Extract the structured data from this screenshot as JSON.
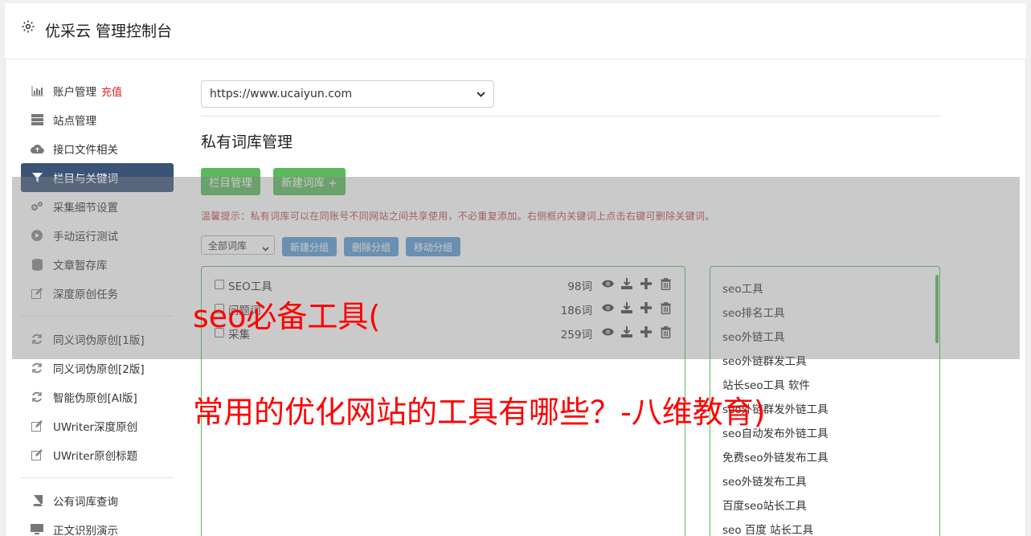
{
  "header": {
    "title": "优采云 管理控制台"
  },
  "sidebar": {
    "group1": [
      {
        "icon": "bar-chart-icon",
        "label": "账户管理",
        "badge": "充值"
      },
      {
        "icon": "server-icon",
        "label": "站点管理"
      },
      {
        "icon": "cloud-upload-icon",
        "label": "接口文件相关"
      },
      {
        "icon": "filter-icon",
        "label": "栏目与关键词",
        "active": true
      },
      {
        "icon": "gears-icon",
        "label": "采集细节设置"
      },
      {
        "icon": "play-circle-icon",
        "label": "手动运行测试"
      },
      {
        "icon": "database-icon",
        "label": "文章暂存库"
      },
      {
        "icon": "edit-icon",
        "label": "深度原创任务"
      }
    ],
    "group2": [
      {
        "icon": "refresh-icon",
        "label": "同义词伪原创[1版]"
      },
      {
        "icon": "refresh-icon",
        "label": "同义词伪原创[2版]"
      },
      {
        "icon": "refresh-icon",
        "label": "智能伪原创[AI版]"
      },
      {
        "icon": "edit-icon",
        "label": "UWriter深度原创"
      },
      {
        "icon": "edit-icon",
        "label": "UWriter原创标题"
      }
    ],
    "group3": [
      {
        "icon": "book-icon",
        "label": "公有词库查询"
      },
      {
        "icon": "monitor-icon",
        "label": "正文识别演示"
      }
    ]
  },
  "main": {
    "site_select": "https://www.ucaiyun.com",
    "section_title": "私有词库管理",
    "btn_column": "栏目管理",
    "btn_new_lib": "新建词库 +",
    "tip": "温馨提示：私有词库可以在同账号不同网站之间共享使用，不必重复添加。右侧框内关键词上点击右键可删除关键词。",
    "group_select": "全部词库",
    "btn_new_group": "新建分组",
    "btn_delete_group": "删除分组",
    "btn_move_group": "移动分组",
    "libraries": [
      {
        "name": "SEO工具",
        "count": "98词"
      },
      {
        "name": "问题词",
        "count": "186词"
      },
      {
        "name": "采集",
        "count": "259词"
      }
    ],
    "keywords": [
      "seo工具",
      "seo排名工具",
      "seo外链工具",
      "seo外链群发工具",
      "站长seo工具 软件",
      "seo外链群发外链工具",
      "seo自动发布外链工具",
      "免费seo外链发布工具",
      "seo外链发布工具",
      "百度seo站长工具",
      "seo 百度 站长工具"
    ]
  },
  "overlay": {
    "line1": "seo必备工具(",
    "line2": "常用的优化网站的工具有哪些？-八维教育)"
  }
}
